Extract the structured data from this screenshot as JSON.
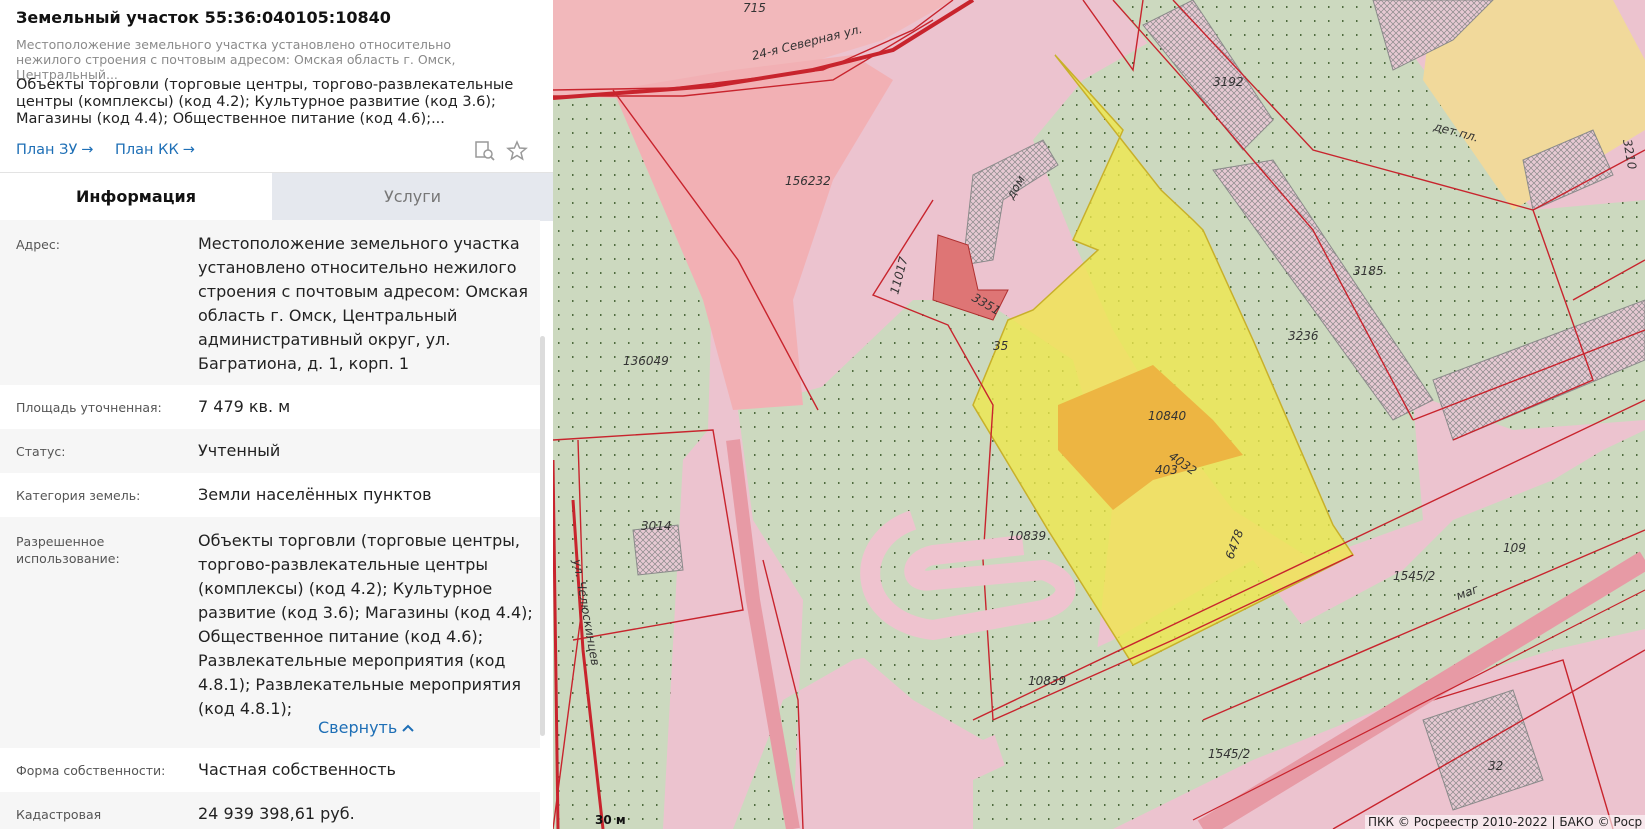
{
  "panel": {
    "title": "Земельный участок 55:36:040105:10840",
    "subtitle": "Местоположение земельного участка установлено относительно нежилого строения с почтовым адресом: Омская область г. Омск, Центральный...",
    "permitted_use_short": "Объекты торговли (торговые центры, торгово-развлекательные центры (комплексы) (код 4.2); Культурное развитие (код 3.6); Магазины (код 4.4); Общественное питание (код 4.6);...",
    "links": {
      "plan_zu": "План ЗУ",
      "plan_kk": "План КК",
      "arrow": "→"
    },
    "icons": [
      "search-doc-icon",
      "star-icon"
    ]
  },
  "tabs": {
    "info": "Информация",
    "services": "Услуги"
  },
  "info": {
    "address": {
      "label": "Адрес:",
      "value": "Местоположение земельного участка установлено относительно нежилого строения с почтовым адресом: Омская область г. Омск, Центральный административный округ, ул. Багратиона, д. 1, корп. 1"
    },
    "area": {
      "label": "Площадь уточненная:",
      "value": "7 479 кв. м"
    },
    "status": {
      "label": "Статус:",
      "value": "Учтенный"
    },
    "category": {
      "label": "Категория земель:",
      "value": "Земли населённых пунктов"
    },
    "permitted_use": {
      "label": "Разрешенное использование:",
      "value": "Объекты торговли (торговые центры, торгово-развлекательные центры (комплексы) (код 4.2); Культурное развитие (код 3.6); Магазины (код 4.4); Общественное питание (код 4.6); Развлекательные мероприятия (код 4.8.1); Развлекательные мероприятия (код 4.8.1);"
    },
    "collapse": "Свернуть",
    "ownership": {
      "label": "Форма собственности:",
      "value": "Частная собственность"
    },
    "cadastral_value": {
      "label": "Кадастровая стоимость:",
      "value": "24 939 398,61 руб."
    }
  },
  "map": {
    "street_1": "24-я Северная ул.",
    "street_2": "ул. Челюскинцев",
    "parcel_labels": [
      "715",
      "3192",
      "дет.пл.",
      "3210",
      "156232",
      "11017",
      "3351",
      "35",
      "3185",
      "3236",
      "136049",
      "10840",
      "4032",
      "403",
      "6478",
      "10839",
      "10839",
      "3014",
      "109",
      "1545/2",
      "1545/2",
      "32",
      "дом",
      "маг"
    ],
    "scale": "30 м",
    "attribution": "ПКК © Росреестр 2010-2022 | БАКО © Роср"
  },
  "colors": {
    "accent": "#1e6fb6",
    "selected_parcel": "#f0e84a",
    "parcel_border": "#c8242d",
    "green_area": "#ccd9bf",
    "road": "#ecc3cf"
  }
}
